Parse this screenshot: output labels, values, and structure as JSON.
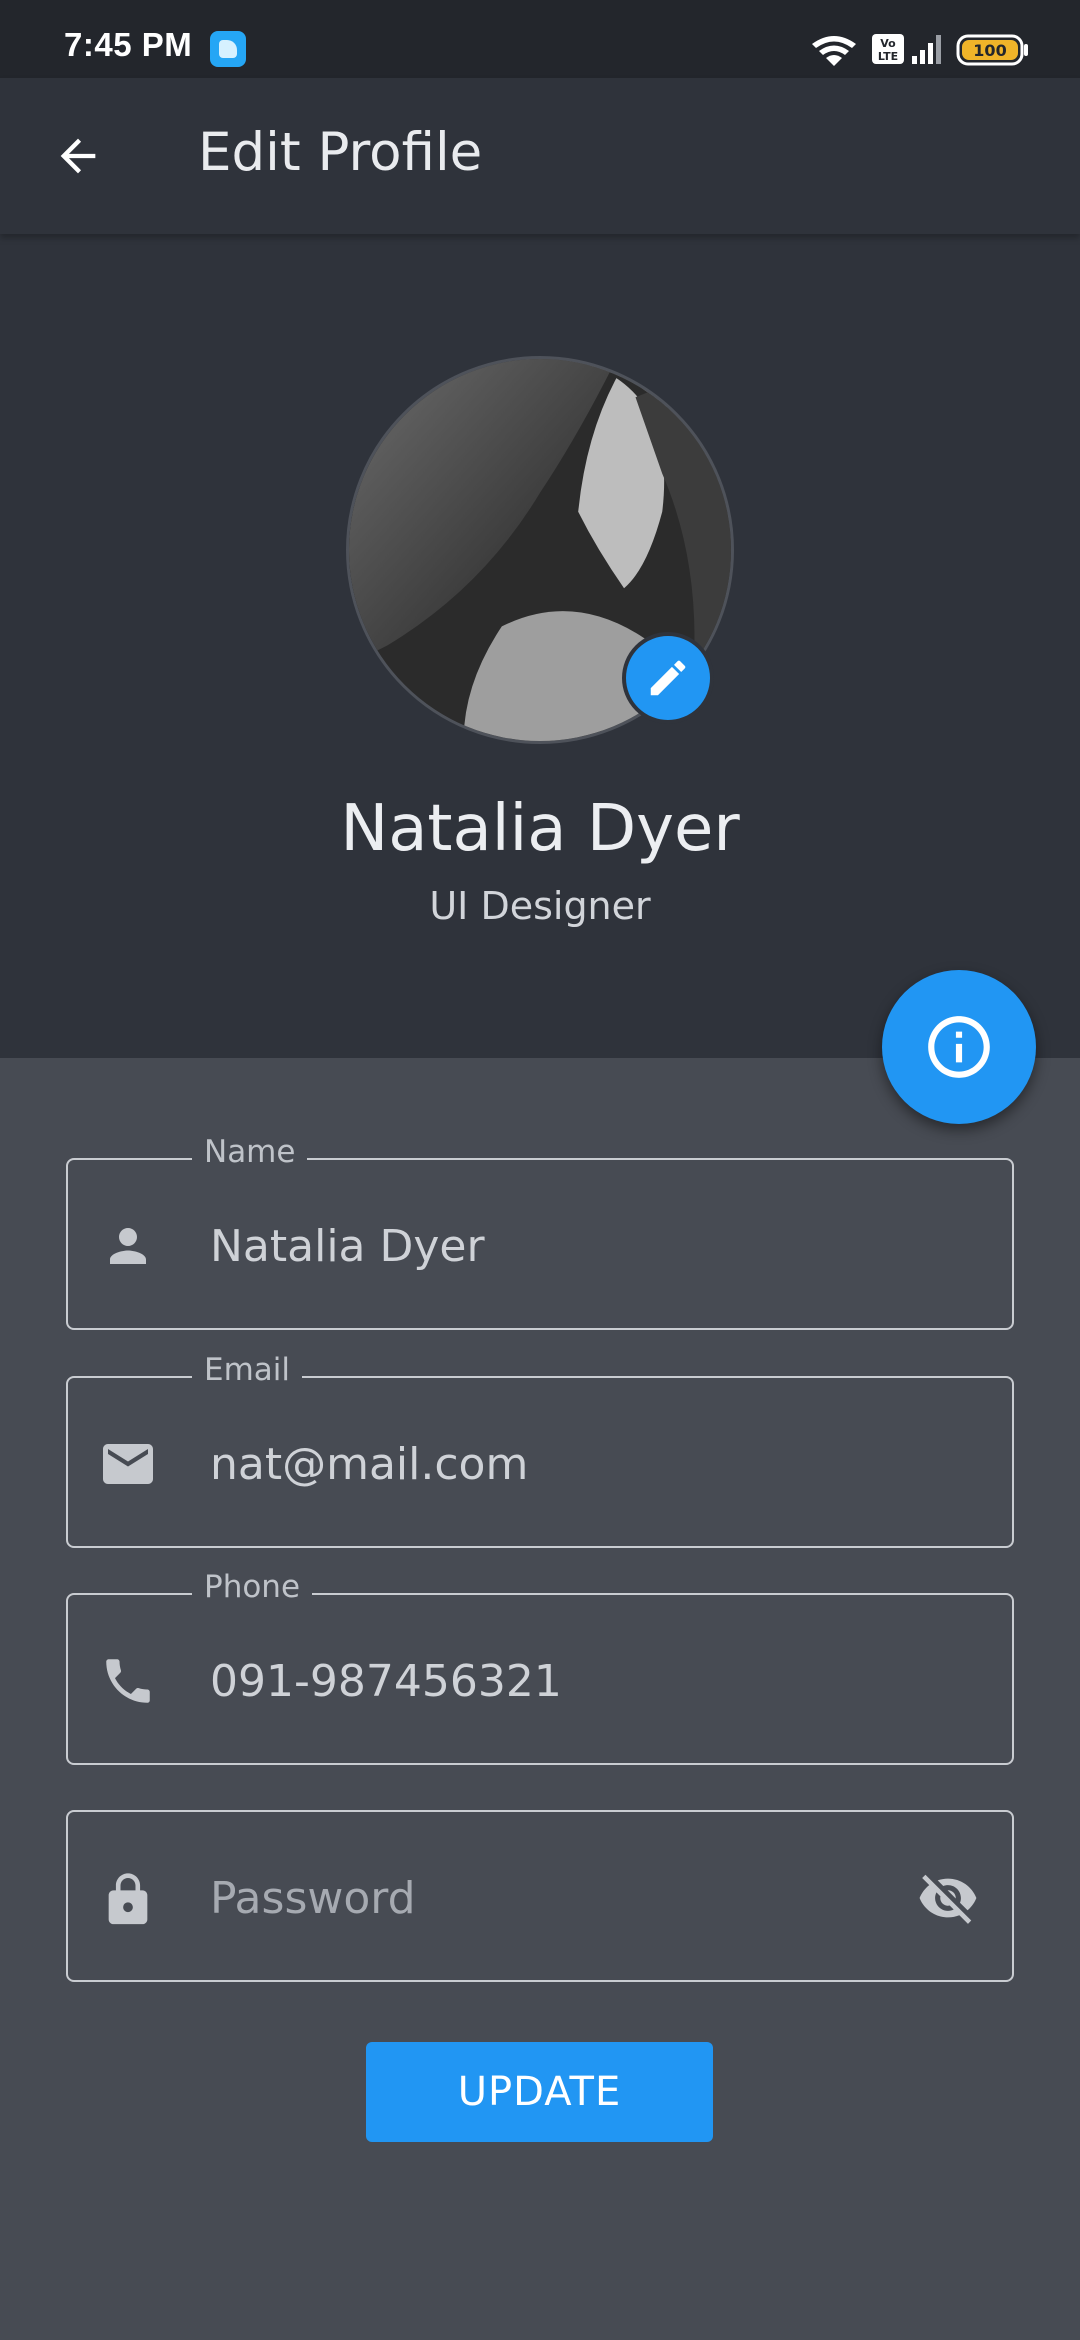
{
  "status_bar": {
    "time": "7:45 PM",
    "battery": "100",
    "icons": [
      "app-notification-icon",
      "wifi-icon",
      "volte-icon",
      "signal-icon",
      "battery-icon"
    ]
  },
  "app_bar": {
    "title": "Edit Profile",
    "back_icon": "arrow-back-icon"
  },
  "profile": {
    "name": "Natalia Dyer",
    "role": "UI Designer",
    "edit_icon": "pencil-icon"
  },
  "fab": {
    "icon": "info-icon"
  },
  "form": {
    "name": {
      "label": "Name",
      "value": "Natalia Dyer",
      "icon": "person-icon"
    },
    "email": {
      "label": "Email",
      "value": "nat@mail.com",
      "icon": "mail-icon"
    },
    "phone": {
      "label": "Phone",
      "value": "091-987456321",
      "icon": "phone-icon"
    },
    "password": {
      "placeholder": "Password",
      "value": "",
      "icon": "lock-icon",
      "toggle_icon": "visibility-off-icon"
    }
  },
  "update_button": {
    "label": "UPDATE"
  },
  "colors": {
    "accent": "#2196f3",
    "header_bg": "#2f333b",
    "body_bg": "#474b53",
    "status_bar_bg": "#23262c"
  }
}
